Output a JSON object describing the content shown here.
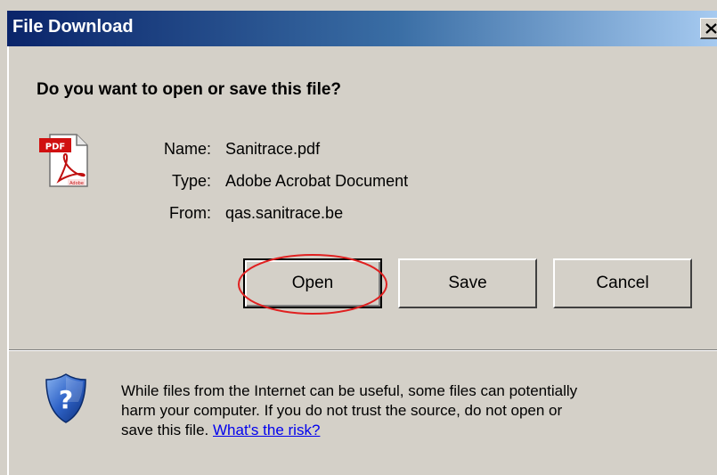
{
  "window": {
    "title": "File Download",
    "close_label": "×"
  },
  "dialog": {
    "question": "Do you want to open or save this file?",
    "file": {
      "icon": "pdf-file-icon",
      "name_label": "Name:",
      "name": "Sanitrace.pdf",
      "type_label": "Type:",
      "type": "Adobe Acrobat Document",
      "from_label": "From:",
      "from": "qas.sanitrace.be"
    },
    "buttons": {
      "open": "Open",
      "save": "Save",
      "cancel": "Cancel"
    },
    "annotation": {
      "type": "red-ellipse",
      "target": "open-button",
      "color": "#e02020"
    },
    "warning": {
      "icon": "help-shield-icon",
      "line1": "While files from the Internet can be useful, some files can potentially",
      "line2": "harm your computer. If you do not trust the source, do not open or",
      "line3_prefix": "save this file.",
      "link": "What's the risk?"
    }
  },
  "colors": {
    "dialog_bg": "#d4d0c8",
    "titlebar_start": "#0a246a",
    "titlebar_end": "#a6caf0",
    "link": "#0000ee"
  }
}
